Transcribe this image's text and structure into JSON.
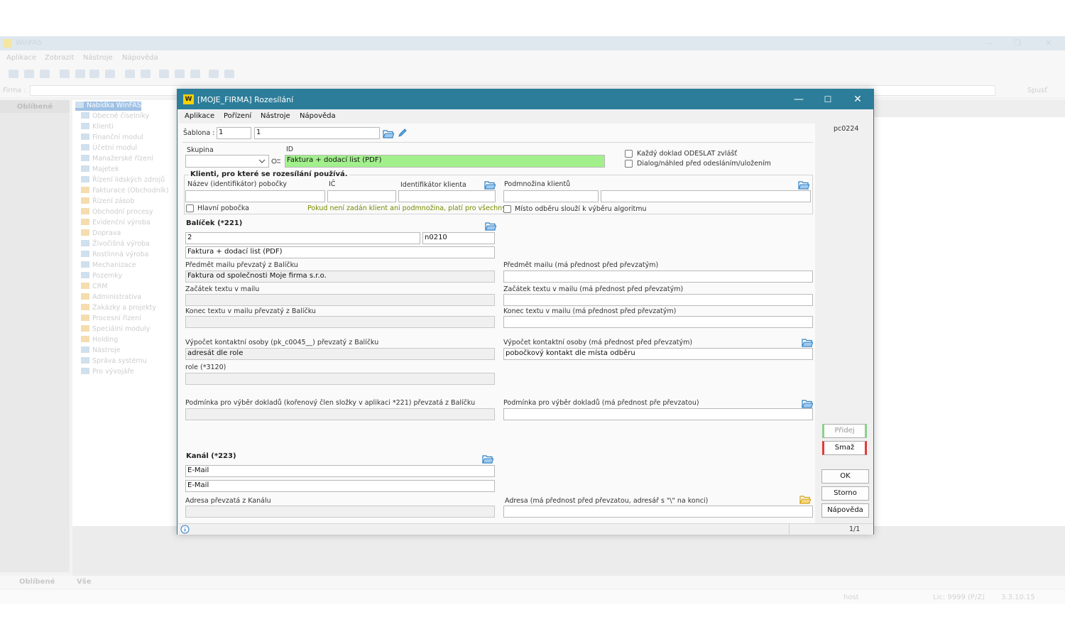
{
  "background_app": {
    "title": "WinFAS",
    "menu": [
      "Aplikace",
      "Zobrazit",
      "Nástroje",
      "Nápověda"
    ],
    "firma_label": "Firma :",
    "spust_label": "Spusť",
    "left_panel_title": "Oblíbené",
    "tree_items": [
      "Nabídka WinFAS",
      "Obecné číselníky",
      "Klienti",
      "Finanční modul",
      "Účetní modul",
      "Manažerské řízení",
      "Majetek",
      "Řízení lidských zdrojů",
      "Fakturace (Obchodník)",
      "Řízení zásob",
      "Obchodní procesy",
      "Evidenční výroba",
      "Doprava",
      "Živočišná výroba",
      "Rostlinná výroba",
      "Mechanizace",
      "Pozemky",
      "CRM",
      "Administrativa",
      "Zakázky a projekty",
      "Procesní řízení",
      "Speciální moduly",
      "Holding",
      "Nástroje",
      "Správa systému",
      "Pro vývojáře"
    ],
    "bottom_tabs": [
      "Oblíbené",
      "Vše"
    ],
    "status": {
      "user": "host",
      "lic": "Lic: 9999 (P/Z)",
      "version": "3.3.10.15"
    }
  },
  "dialog": {
    "title": "[MOJE_FIRMA] Rozesílání",
    "logo": "W",
    "menu": [
      "Aplikace",
      "Pořízení",
      "Nástroje",
      "Nápověda"
    ],
    "pc_code": "pc0224",
    "sablona": {
      "label": "Šablona :",
      "value1": "1",
      "value2": "1"
    },
    "skupina_label": "Skupina",
    "id_label": "ID",
    "id_value": "Faktura + dodací list (PDF)",
    "checkbox_odeslat": "Každý doklad ODESLAT zvlášť",
    "checkbox_dialog": "Dialog/náhled před odesláním/uložením",
    "klienti": {
      "title": "Klienti, pro které se rozesílání používá.",
      "pobocka_label": "Název (identifikátor) pobočky",
      "ic_label": "IČ",
      "identifikator_label": "Identifikátor klienta",
      "podmnozina_label": "Podmnožina klientů",
      "hlavni_pobocka": "Hlavní pobočka",
      "note": "Pokud není zadán klient ani podmnožina, platí pro všechny.",
      "misto_odberu": "Místo odběru slouží k výběru algoritmu"
    },
    "balicek": {
      "title": "Balíček (*221)",
      "value": "2",
      "code": "n0210",
      "name": "Faktura + dodací list (PDF)",
      "predmet_label": "Předmět mailu převzatý z Balíčku",
      "predmet_value": "Faktura od společnosti Moje firma s.r.o.",
      "predmet_priority_label": "Předmět mailu (má přednost před převzatým)",
      "zacatek_label": "Začátek textu v mailu",
      "zacatek_priority_label": "Začátek textu v mailu (má přednost před převzatým)",
      "konec_label": "Konec textu v mailu převzatý z Balíčku",
      "konec_priority_label": "Konec textu v mailu (má přednost před převzatým)",
      "vypocet_label": "Výpočet kontaktní osoby (pk_c0045__) převzatý z Balíčku",
      "vypocet_value": "adresát dle role",
      "vypocet_priority_label": "Výpočet kontaktní osoby (má přednost před převzatým)",
      "vypocet_priority_value": "pobočkový kontakt dle místa odběru",
      "role_label": "role (*3120)",
      "podminka_label": "Podmínka pro výběr dokladů (kořenový člen složky v aplikaci *221) převzatá z Balíčku",
      "podminka_priority_label": "Podmínka pro výběr dokladů (má přednost pře převzatou)"
    },
    "kanal": {
      "title": "Kanál (*223)",
      "value1": "E-Mail",
      "value2": "E-Mail",
      "adresa_label": "Adresa převzatá z Kanálu",
      "adresa_priority_label": "Adresa (má přednost před převzatou, adresář s \"\\\" na konci)"
    },
    "buttons": {
      "pridej": "Přidej",
      "smaz": "Smaž",
      "ok": "OK",
      "storno": "Storno",
      "napoveda": "Nápověda"
    },
    "status_page": "1/1",
    "colors": {
      "titlebar": "#2c7d99",
      "id_highlight": "#a2f08c",
      "note": "#7a8a00",
      "add_marker": "#4caf50",
      "delete_marker": "#e53935"
    }
  }
}
